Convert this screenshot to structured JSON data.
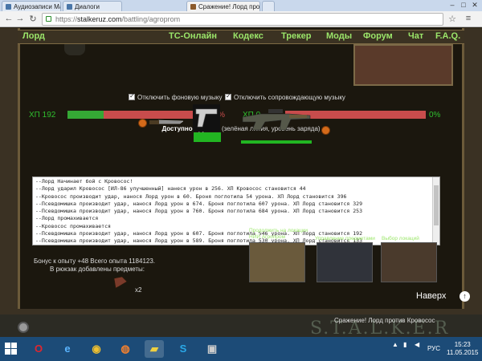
{
  "browser": {
    "tabs": [
      {
        "label": "Аудиозаписи Макса Хи...",
        "icon_color": "#4a76a8"
      },
      {
        "label": "Диалоги",
        "icon_color": "#4a76a8"
      },
      {
        "label": "Сражение! Лорд против...",
        "icon_color": "#8b5a2b"
      }
    ],
    "url_scheme": "https://",
    "url_host": "stalkeruz.com",
    "url_path": "/battling/agroprom"
  },
  "menu": {
    "items": [
      "Лорд",
      "ТС-Онлайн",
      "Кодекс",
      "Трекер",
      "Моды",
      "Форум",
      "Чат",
      "F.A.Q."
    ]
  },
  "options": {
    "bg_music": "Отключить фоновую музыку",
    "sfx_music": "Отключить сопровождающую музыку"
  },
  "player": {
    "hp_label": "ХП 192",
    "hp_fraction": 0.27,
    "hp_pct": "27%"
  },
  "enemy": {
    "hp_label": "ХП 0",
    "hp_fraction": 0.0,
    "hp_pct": "0%"
  },
  "weapons": {
    "title_bold": "Доступно оружие:",
    "title_note": "(зелёная линия, уровень заряда)",
    "items": [
      {
        "name": "knife",
        "charge": 0
      },
      {
        "name": "pistol",
        "charge": 1.0
      },
      {
        "name": "rifle",
        "charge": 1.0
      }
    ]
  },
  "log": [
    "--Лорд Начинает бой с Кровосос!",
    "--Лорд ударил Кровосос [ИЛ-86 улучшенный] нанеся урон в 256. ХП Кровосос становится 44",
    "--Кровосос производит удар, нанося Лорд урон в 60. Броня поглотила 54 урона. ХП Лорд становится 396",
    "--Псевдомишка производит удар, нанося Лорд урон в 674. Броня поглотила 607 урона. ХП Лорд становится 329",
    "--Псевдомишка производит удар, нанося Лорд урон в 760. Броня поглотила 684 урона. ХП Лорд становится 253",
    "--Лорд промахивается",
    "--Кровосос промахивается",
    "--Псевдомишка производит удар, нанося Лорд урон в 607. Броня поглотила 546 урона. ХП Лорд становится 192",
    "--Псевдомишка производит удар, нанося Лорд урон в 589. Броня поглотила 530 урона. ХП Лорд становится 133"
  ],
  "bonus": {
    "line1": "Бонус к опыту +48 Всего опыта 1184123.",
    "line2": "В рюкзак добавлены предметы:",
    "loot_count": "x2"
  },
  "panels": {
    "continue": "Продолжить на локации НИИ Агропром",
    "manage": "Управление предметами",
    "locations": "Выбор локаций"
  },
  "footer": {
    "to_top": "Наверх",
    "title": "Сражение! Лорд против Кровосос",
    "logo": "S.T.A.L.K.E.R."
  },
  "taskbar": {
    "lang": "РУС",
    "time": "15:23",
    "date": "11.05.2015"
  }
}
